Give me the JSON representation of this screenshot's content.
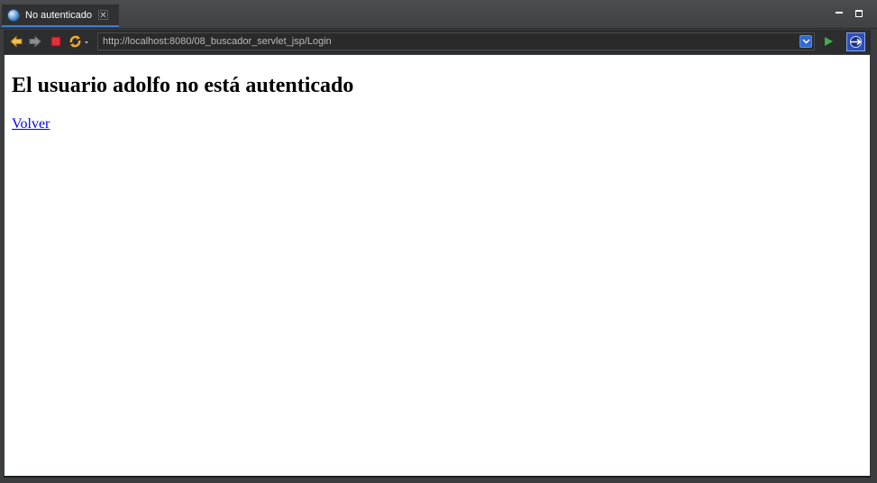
{
  "tab": {
    "title": "No autenticado",
    "icon": "globe-icon",
    "close_icon": "close-icon",
    "close_glyph": "✕"
  },
  "window": {
    "minimize_icon": "minimize-icon",
    "maximize_icon": "maximize-icon"
  },
  "toolbar": {
    "back_icon": "back-arrow-icon",
    "forward_icon": "forward-arrow-icon",
    "stop_icon": "stop-icon",
    "refresh_icon": "refresh-icon",
    "url": "http://localhost:8080/08_buscador_servlet_jsp/Login",
    "dropdown_icon": "chevron-down-icon",
    "go_icon": "go-play-icon",
    "external_icon": "open-external-browser-icon"
  },
  "page": {
    "heading": "El usuario adolfo no está autenticado",
    "link_label": "Volver"
  },
  "colors": {
    "accent": "#3c7bd6",
    "link": "#0000ee",
    "go_green": "#3fae49",
    "stop_red": "#e0303a",
    "arrow_orange": "#f2a82c"
  }
}
